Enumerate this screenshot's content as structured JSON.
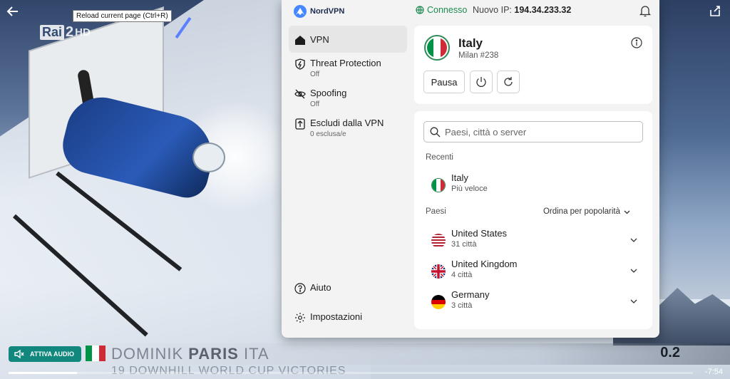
{
  "browser": {
    "tooltip": "Reload current page (Ctrl+R)"
  },
  "video": {
    "channel": {
      "logo_text": "Rai",
      "logo_number": "2",
      "logo_hd": "HD"
    },
    "audio_button": "ATTIVA AUDIO",
    "ticker": {
      "first_name": "DOMINIK",
      "last_name": "PARIS",
      "nation": "ITA",
      "score": "0.2"
    },
    "subline": "19 DOWNHILL WORLD CUP VICTORIES",
    "time_left": "-7:54",
    "progress_fraction": 0.1
  },
  "nordvpn": {
    "brand": "NordVPN",
    "status": "Connesso",
    "ip_label": "Nuovo IP:",
    "ip_value": "194.34.233.32",
    "sidebar": {
      "vpn": {
        "label": "VPN"
      },
      "threat": {
        "label": "Threat Protection",
        "sub": "Off"
      },
      "spoofing": {
        "label": "Spoofing",
        "sub": "Off"
      },
      "split": {
        "label": "Escludi dalla VPN",
        "sub": "0 esclusa/e"
      },
      "help": {
        "label": "Aiuto"
      },
      "settings": {
        "label": "Impostazioni"
      }
    },
    "connection": {
      "country": "Italy",
      "server": "Milan #238",
      "pause_label": "Pausa"
    },
    "search": {
      "placeholder": "Paesi, città o server"
    },
    "recent_label": "Recenti",
    "recent": {
      "name": "Italy",
      "sub": "Più veloce"
    },
    "countries_label": "Paesi",
    "sort_label": "Ordina per popolarità",
    "countries": [
      {
        "name": "United States",
        "sub": "31 città"
      },
      {
        "name": "United Kingdom",
        "sub": "4 città"
      },
      {
        "name": "Germany",
        "sub": "3 città"
      }
    ],
    "colors": {
      "connected": "#1d8a50",
      "italy_green": "#009246",
      "italy_red": "#ce2b37"
    }
  }
}
